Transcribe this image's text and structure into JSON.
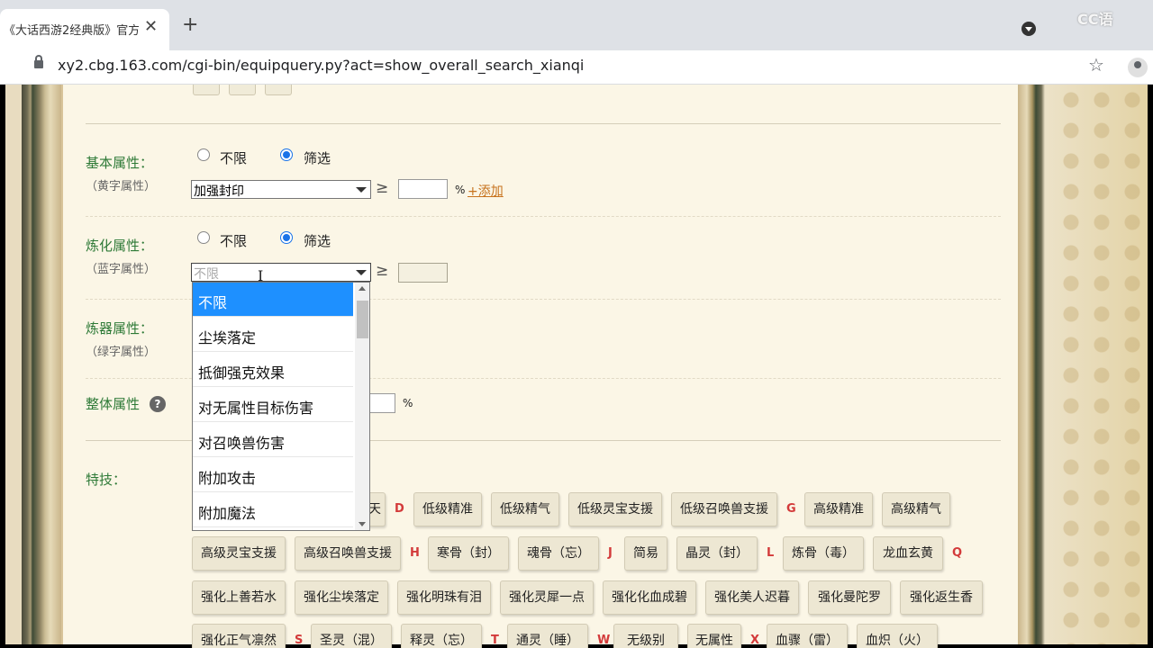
{
  "browser": {
    "tab_title": "《大话西游2经典版》官方",
    "tab_close": "✕",
    "new_tab": "+",
    "url": "xy2.cbg.163.com/cgi-bin/equipquery.py?act=show_overall_search_xianqi",
    "star": "☆",
    "overlay_logo": "CC语"
  },
  "sections": {
    "basic": {
      "label": "基本属性：",
      "sublabel": "（黄字属性）",
      "radio_unlimited": "不限",
      "radio_filter": "筛选",
      "select_value": "加强封印",
      "gte": "≥",
      "pct": "%",
      "add_link": "+添加"
    },
    "refine": {
      "label": "炼化属性：",
      "sublabel": "（蓝字属性）",
      "radio_unlimited": "不限",
      "radio_filter": "筛选",
      "select_placeholder": "不限",
      "gte": "≥"
    },
    "forge": {
      "label": "炼器属性：",
      "sublabel": "（绿字属性）"
    },
    "overall": {
      "label": "整体属性",
      "help": "?",
      "pct": "%"
    },
    "skills": {
      "label": "特技："
    }
  },
  "dropdown": {
    "options": [
      "不限",
      "尘埃落定",
      "抵御强克效果",
      "对无属性目标伤害",
      "对召唤兽伤害",
      "附加攻击",
      "附加魔法"
    ],
    "selected_index": 0
  },
  "tags": {
    "row1_partial": "天",
    "letter_D": "D",
    "r1": [
      "低级精准",
      "低级精气",
      "低级灵宝支援",
      "低级召唤兽支援"
    ],
    "letter_G": "G",
    "r1b": [
      "高级精准",
      "高级精气"
    ],
    "r2a": [
      "高级灵宝支援",
      "高级召唤兽支援"
    ],
    "letter_H": "H",
    "r2b": [
      "寒骨（封）",
      "魂骨（忘）"
    ],
    "letter_J": "J",
    "r2c": [
      "简易",
      "晶灵（封）"
    ],
    "letter_L": "L",
    "r2d": [
      "炼骨（毒）",
      "龙血玄黄"
    ],
    "letter_Q": "Q",
    "r3": [
      "强化上善若水",
      "强化尘埃落定",
      "强化明珠有泪",
      "强化灵犀一点",
      "强化化血成碧",
      "强化美人迟暮",
      "强化曼陀罗",
      "强化返生香"
    ],
    "r4a": [
      "强化正气凛然"
    ],
    "letter_S": "S",
    "r4b": [
      "圣灵（混）",
      "释灵（忘）"
    ],
    "letter_T": "T",
    "r4c": [
      "通灵（睡）"
    ],
    "letter_W": "W",
    "r4d": [
      "无级别",
      "无属性"
    ],
    "letter_X": "X",
    "r4e": [
      "血骤（雷）",
      "血炽（火）"
    ]
  }
}
